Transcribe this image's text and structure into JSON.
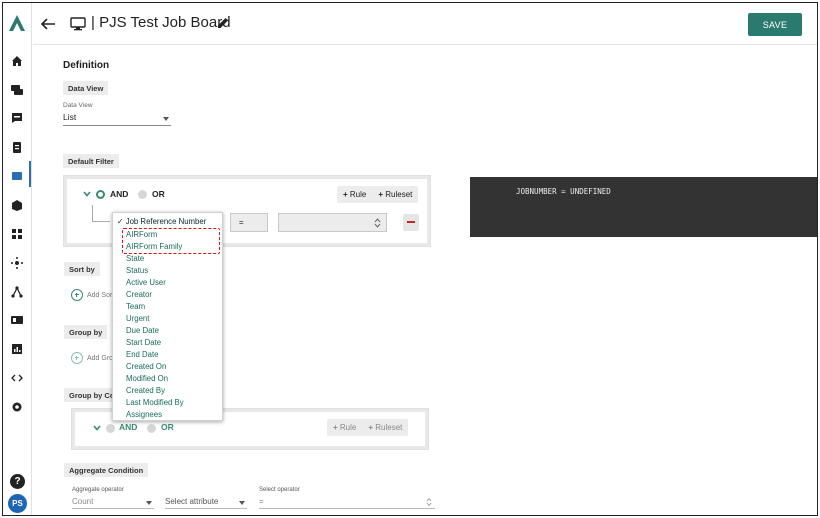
{
  "header": {
    "title": "PJS Test Job Board",
    "save_label": "SAVE"
  },
  "sidebar": {
    "avatar_initials": "PS",
    "help_glyph": "?",
    "icons": [
      "home-icon",
      "chat-icon",
      "message-icon",
      "clipboard-icon",
      "board-icon",
      "box-icon",
      "dashboard-icon",
      "network-icon",
      "hierarchy-icon",
      "id-card-icon",
      "chart-icon",
      "code-icon",
      "gear-icon"
    ]
  },
  "definition": {
    "heading": "Definition",
    "data_view_chip": "Data View",
    "data_view_label": "Data View",
    "data_view_value": "List",
    "default_filter_chip": "Default Filter",
    "filter": {
      "and_label": "AND",
      "or_label": "OR",
      "rule_label": "Rule",
      "ruleset_label": "Ruleset",
      "operator_value": "="
    },
    "expression": "JOBNUMBER = UNDEFINED",
    "sort_by_chip": "Sort by",
    "add_sort_label": "Add Sort",
    "group_by_chip": "Group by",
    "add_group_label": "Add Group",
    "group_by_condition_chip": "Group by Condition",
    "group_filter": {
      "and_label": "AND",
      "or_label": "OR",
      "rule_label": "Rule",
      "ruleset_label": "Ruleset"
    },
    "aggregate_chip": "Aggregate Condition",
    "aggregate_operator_label": "Aggregate operator",
    "aggregate_operator_value": "Count",
    "select_attribute_placeholder": "Select attribute",
    "select_operator_label": "Select operator",
    "select_operator_value": "="
  },
  "dropdown": {
    "selected": "✓ Job Reference Number",
    "items": [
      "AIRForm",
      "AIRForm Family",
      "State",
      "Status",
      "Active User",
      "Creator",
      "Team",
      "Urgent",
      "Due Date",
      "Start Date",
      "End Date",
      "Created On",
      "Modified On",
      "Created By",
      "Last Modified By",
      "Assignees"
    ]
  },
  "colors": {
    "accent": "#2b7a6f",
    "item_text": "#1a6b5c",
    "highlight": "#dd1111",
    "code_bg": "#333333",
    "avatar": "#1f64b5"
  }
}
